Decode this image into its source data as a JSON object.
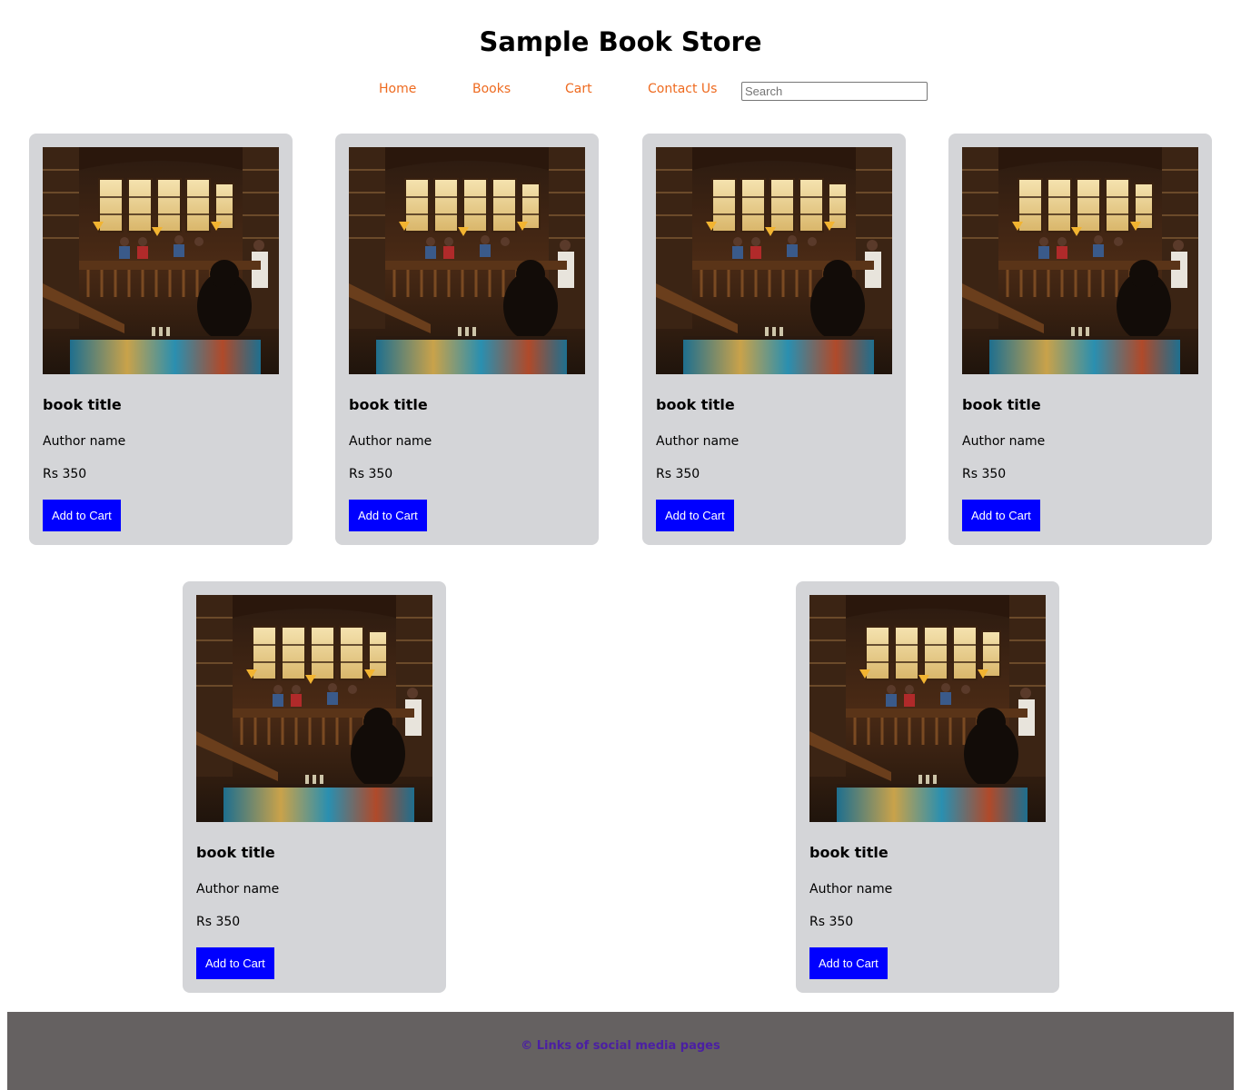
{
  "header": {
    "title": "Sample Book Store"
  },
  "nav": {
    "home": "Home",
    "books": "Books",
    "cart": "Cart",
    "contact": "Contact Us",
    "search_placeholder": "Search"
  },
  "books": [
    {
      "title": "book title",
      "author": "Author name",
      "price": "Rs 350",
      "button": "Add to Cart"
    },
    {
      "title": "book title",
      "author": "Author name",
      "price": "Rs 350",
      "button": "Add to Cart"
    },
    {
      "title": "book title",
      "author": "Author name",
      "price": "Rs 350",
      "button": "Add to Cart"
    },
    {
      "title": "book title",
      "author": "Author name",
      "price": "Rs 350",
      "button": "Add to Cart"
    },
    {
      "title": "book title",
      "author": "Author name",
      "price": "Rs 350",
      "button": "Add to Cart"
    },
    {
      "title": "book title",
      "author": "Author name",
      "price": "Rs 350",
      "button": "Add to Cart"
    }
  ],
  "footer": {
    "text": "© Links of social media pages"
  },
  "colors": {
    "nav_link": "#ee6a1f",
    "card_bg": "#d4d5d8",
    "button_bg": "#0000ff",
    "footer_bg": "#656161",
    "footer_text": "#4b1fa3"
  },
  "icons": {
    "cover_image": "library-interior-image"
  }
}
